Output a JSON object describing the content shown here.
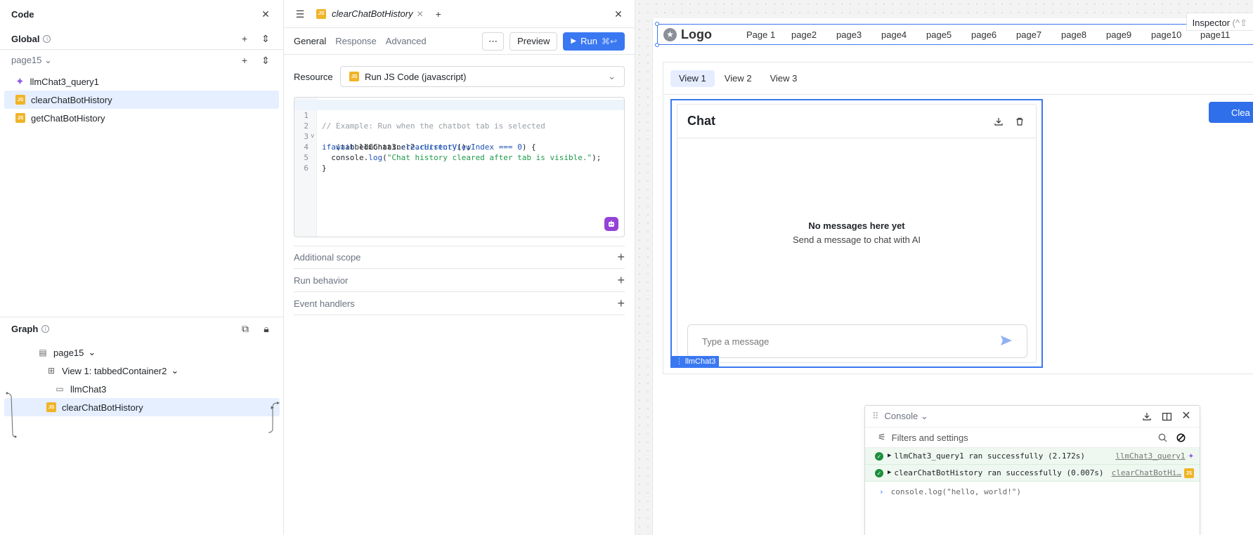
{
  "left_panel": {
    "title": "Code",
    "global_label": "Global",
    "page_label": "page15",
    "items": [
      {
        "label": "llmChat3_query1",
        "type": "ai"
      },
      {
        "label": "clearChatBotHistory",
        "type": "js",
        "selected": true
      },
      {
        "label": "getChatBotHistory",
        "type": "js"
      }
    ],
    "graph": {
      "title": "Graph",
      "page": "page15",
      "view": "View 1: tabbedContainer2",
      "component": "llmChat3",
      "query": "clearChatBotHistory"
    }
  },
  "editor": {
    "tab_label": "clearChatBotHistory",
    "subtabs": [
      "General",
      "Response",
      "Advanced"
    ],
    "preview_label": "Preview",
    "run_label": "Run",
    "run_shortcut": "⌘↩",
    "resource_label": "Resource",
    "resource_value": "Run JS Code (javascript)",
    "code_lines": [
      "// Example: Run when the chatbot tab is selected",
      "if (tabbedContainer2.currentViewIndex === 0) {",
      "  await llmChat3.clearHistory();",
      "  console.log(\"Chat history cleared after tab is visible.\");",
      "}",
      ""
    ],
    "line_numbers": [
      "1",
      "2",
      "3",
      "4",
      "5",
      "6"
    ],
    "sections": [
      "Additional scope",
      "Run behavior",
      "Event handlers"
    ]
  },
  "canvas": {
    "inspector_label": "Inspector",
    "inspector_shortcut": "(^⇧",
    "logo_text": "Logo",
    "nav_pages": [
      "Page 1",
      "page2",
      "page3",
      "page4",
      "page5",
      "page6",
      "page7",
      "page8",
      "page9",
      "page10",
      "page11"
    ],
    "view_tabs": [
      "View 1",
      "View 2",
      "View 3"
    ],
    "clear_button": "Clea",
    "chat": {
      "title": "Chat",
      "empty_title": "No messages here yet",
      "empty_subtitle": "Send a message to chat with AI",
      "input_placeholder": "Type a message",
      "component_label": "llmChat3"
    }
  },
  "console": {
    "title": "Console",
    "filter_label": "Filters and settings",
    "logs": [
      {
        "message": "llmChat3_query1 ran successfully (2.172s)",
        "source": "llmChat3_query1",
        "kind": "ai"
      },
      {
        "message": "clearChatBotHistory ran successfully (0.007s)",
        "source": "clearChatBotHi…",
        "kind": "js"
      }
    ],
    "prompt_text": "console.log(\"hello, world!\")"
  },
  "colors": {
    "accent": "#3a78f2",
    "selected_row": "#e5efff",
    "js_badge": "#f0b429",
    "ai_purple": "#8f5ce8",
    "success": "#1c8f3c"
  }
}
